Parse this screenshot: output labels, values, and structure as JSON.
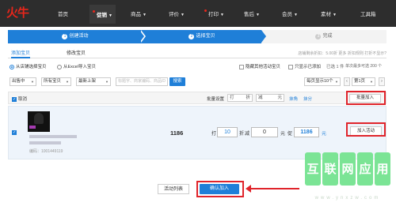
{
  "app": {
    "logo": "火牛"
  },
  "nav": {
    "items": [
      {
        "label": "首页"
      },
      {
        "label": "促销"
      },
      {
        "label": "商品"
      },
      {
        "label": "评价"
      },
      {
        "label": "打印"
      },
      {
        "label": "售后"
      },
      {
        "label": "会员"
      },
      {
        "label": "素材"
      },
      {
        "label": "工具箱"
      }
    ]
  },
  "steps": [
    {
      "num": "1",
      "label": "创建活动"
    },
    {
      "num": "2",
      "label": "选择宝贝"
    },
    {
      "num": "3",
      "label": "完成"
    }
  ],
  "tabs": {
    "add": "添加宝贝",
    "edit": "修改宝贝",
    "note": "店铺剩余折扣：5.00折   更多   折扣规则   打折不显示?"
  },
  "radios": {
    "from_store": "从店铺选择宝贝",
    "from_excel": "从Excel导入宝贝",
    "hide_joined": "隐藏其他活动宝贝",
    "only_discount": "只显示已添加",
    "joined_count": "已选 1 件",
    "max_note": "单次最多可选 200 个"
  },
  "filters": {
    "status": "出售中",
    "category": "所有宝贝",
    "sort": "最新上架",
    "search_placeholder": "标题字、商家编码、商品ID",
    "search_btn": "搜索",
    "per_page": "每页显示10个",
    "page": "第1页"
  },
  "table": {
    "select_all": "取消",
    "batch_setting": "批量设置",
    "discount_label": "打",
    "discount_unit": "折",
    "reduce_label": "减",
    "yuan": "元",
    "round_link": "抹角",
    "fen_link": "抹分",
    "batch_join": "批量加入"
  },
  "row": {
    "code": "编码：1001449119",
    "price": "1186",
    "discount_label": "打",
    "discount_value": "10",
    "discount_unit": "折",
    "reduce_label": "减",
    "reduce_value": "0",
    "yuan_label": "元",
    "promo_label": "促",
    "promo_price": "1186",
    "promo_unit": "元",
    "join_btn": "加入活动"
  },
  "footer": {
    "back": "活动列表",
    "join": "确认加入"
  },
  "watermark": {
    "chars": [
      "互",
      "联",
      "网",
      "应",
      "用"
    ],
    "url": "www.ynxzw.com"
  }
}
